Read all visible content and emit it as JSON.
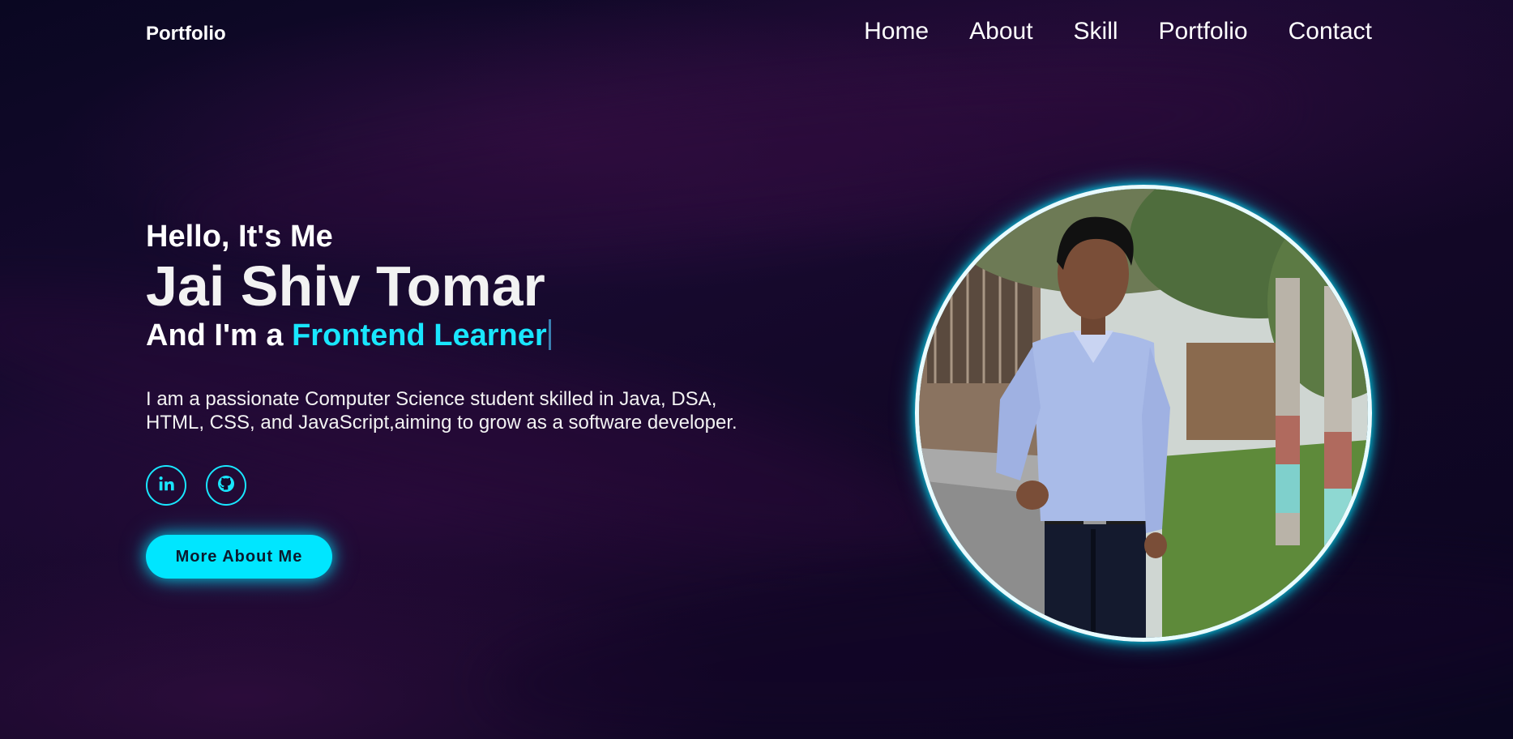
{
  "header": {
    "logo": "Portfolio",
    "nav": [
      "Home",
      "About",
      "Skill",
      "Portfolio",
      "Contact"
    ]
  },
  "hero": {
    "greeting": "Hello, It's Me",
    "name": "Jai Shiv Tomar",
    "role_prefix": "And I'm a",
    "role_highlight": "Frontend Learner",
    "bio": "I am a passionate Computer Science student skilled in Java, DSA, HTML, CSS, and JavaScript,aiming to grow as a software developer.",
    "socials": [
      {
        "icon": "linkedin-icon"
      },
      {
        "icon": "github-icon"
      }
    ],
    "cta_label": "More About Me"
  },
  "profile_photo": {
    "subject": "portrait photo"
  },
  "colors": {
    "accent": "#00e6ff",
    "background": "#0b0620",
    "text": "#ffffff"
  }
}
